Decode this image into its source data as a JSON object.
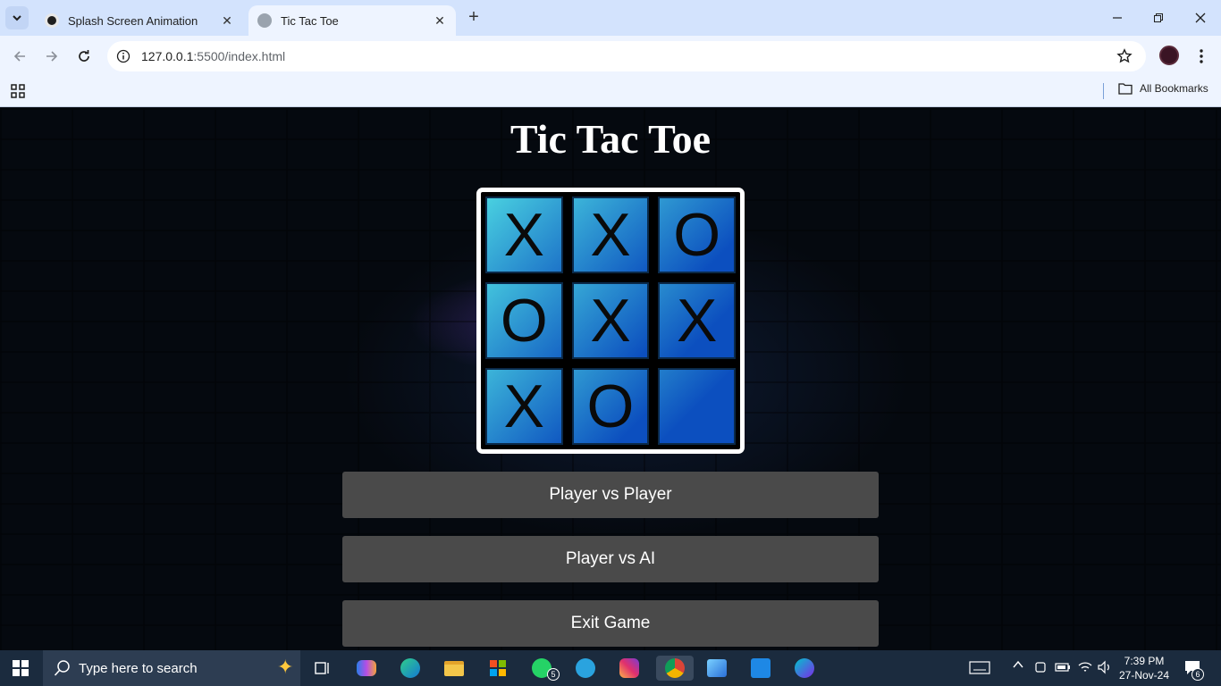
{
  "browser": {
    "tabs": [
      {
        "title": "Splash Screen Animation",
        "close": "✕"
      },
      {
        "title": "Tic Tac Toe",
        "close": "✕"
      }
    ],
    "new_tab": "+",
    "url_host": "127.0.0.1",
    "url_path": ":5500/index.html",
    "bookmarks_label": "All Bookmarks"
  },
  "page": {
    "title": "Tic Tac Toe",
    "board": [
      "X",
      "X",
      "O",
      "O",
      "X",
      "X",
      "X",
      "O",
      ""
    ],
    "buttons": {
      "pvp": "Player vs Player",
      "pvai": "Player vs AI",
      "exit": "Exit Game"
    }
  },
  "taskbar": {
    "search_placeholder": "Type here to search",
    "whatsapp_badge": "5",
    "time": "7:39 PM",
    "date": "27-Nov-24",
    "notifications": "6"
  },
  "colors": {
    "cell_light": "#49d0e0",
    "cell_dark": "#0c4fbf",
    "button_bg": "#4a4a4a"
  }
}
